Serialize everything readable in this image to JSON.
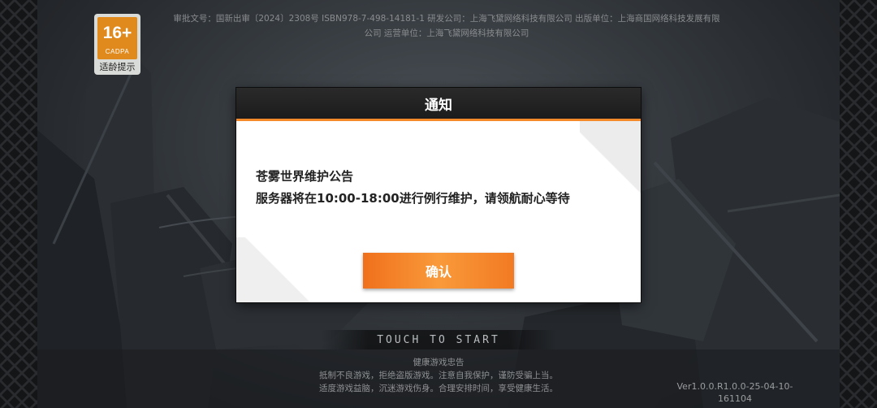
{
  "age_rating": {
    "number": "16+",
    "org": "CADPA",
    "caption": "适龄提示"
  },
  "publish_info": {
    "line1": "审批文号：国新出审〔2024〕2308号 ISBN978-7-498-14181-1 研发公司：上海飞黛网络科技有限公司 出版单位：上海商国网络科技发展有限",
    "line2": "公司 运营单位：上海飞黛网络科技有限公司"
  },
  "dialog": {
    "title": "通知",
    "body_line1": "苍雾世界维护公告",
    "body_line2": "服务器将在10:00-18:00进行例行维护，请领航耐心等待",
    "confirm_label": "确认"
  },
  "touch_to_start": "TOUCH TO START",
  "health_notice": {
    "title": "健康游戏忠告",
    "line1": "抵制不良游戏，拒绝盗版游戏。注意自我保护，谨防受骗上当。",
    "line2": "适度游戏益脑，沉迷游戏伤身。合理安排时间，享受健康生活。"
  },
  "version": {
    "line1": "Ver1.0.0.R1.0.0-25-04-10-",
    "line2": "161104"
  },
  "colors": {
    "accent_orange": "#f58a2a",
    "header_dark": "#1c1c1c"
  }
}
